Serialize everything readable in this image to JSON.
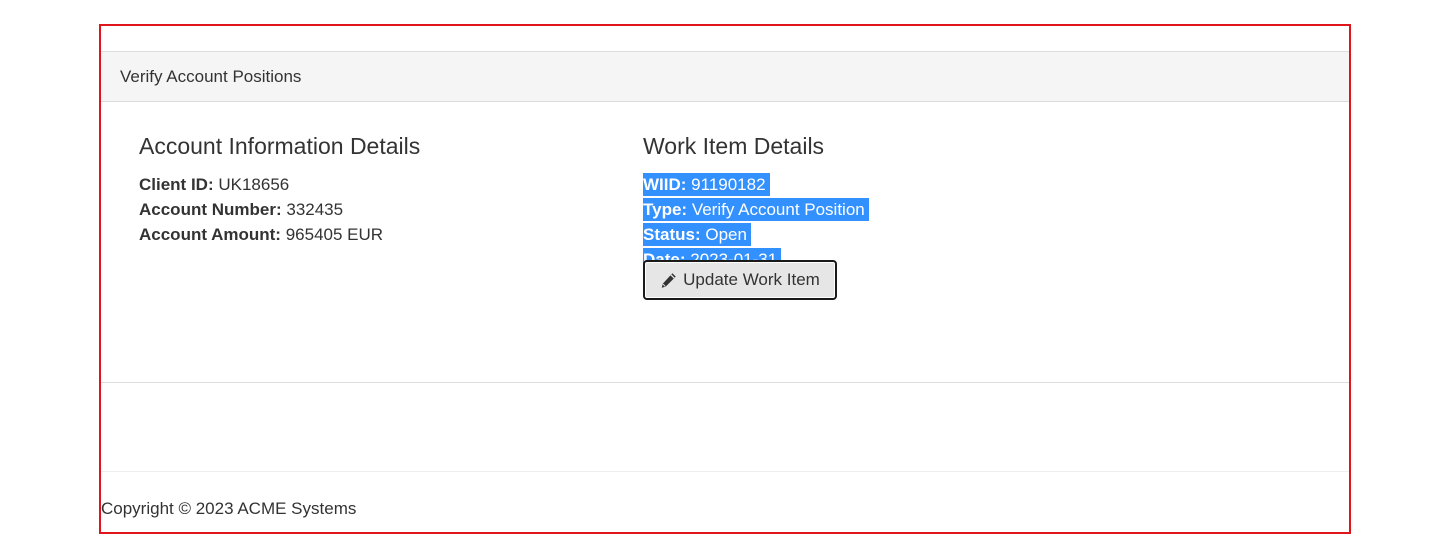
{
  "panel": {
    "heading": "Verify Account Positions"
  },
  "account": {
    "title": "Account Information Details",
    "client_id_label": "Client ID:",
    "client_id": "UK18656",
    "account_number_label": "Account Number:",
    "account_number": "332435",
    "account_amount_label": "Account Amount:",
    "account_amount": "965405 EUR"
  },
  "work_item": {
    "title": "Work Item Details",
    "wiid_label": "WIID:",
    "wiid": "91190182",
    "type_label": "Type:",
    "type": "Verify Account Position",
    "status_label": "Status:",
    "status": "Open",
    "date_label": "Date:",
    "date": "2023-01-31",
    "update_button_label": "Update Work Item",
    "update_button_icon": "pencil-icon"
  },
  "footer": {
    "copyright": "Copyright © 2023 ACME Systems"
  },
  "colors": {
    "frame_border": "#e0151b",
    "selection": "#3390ff",
    "heading_bg": "#f5f5f5"
  }
}
